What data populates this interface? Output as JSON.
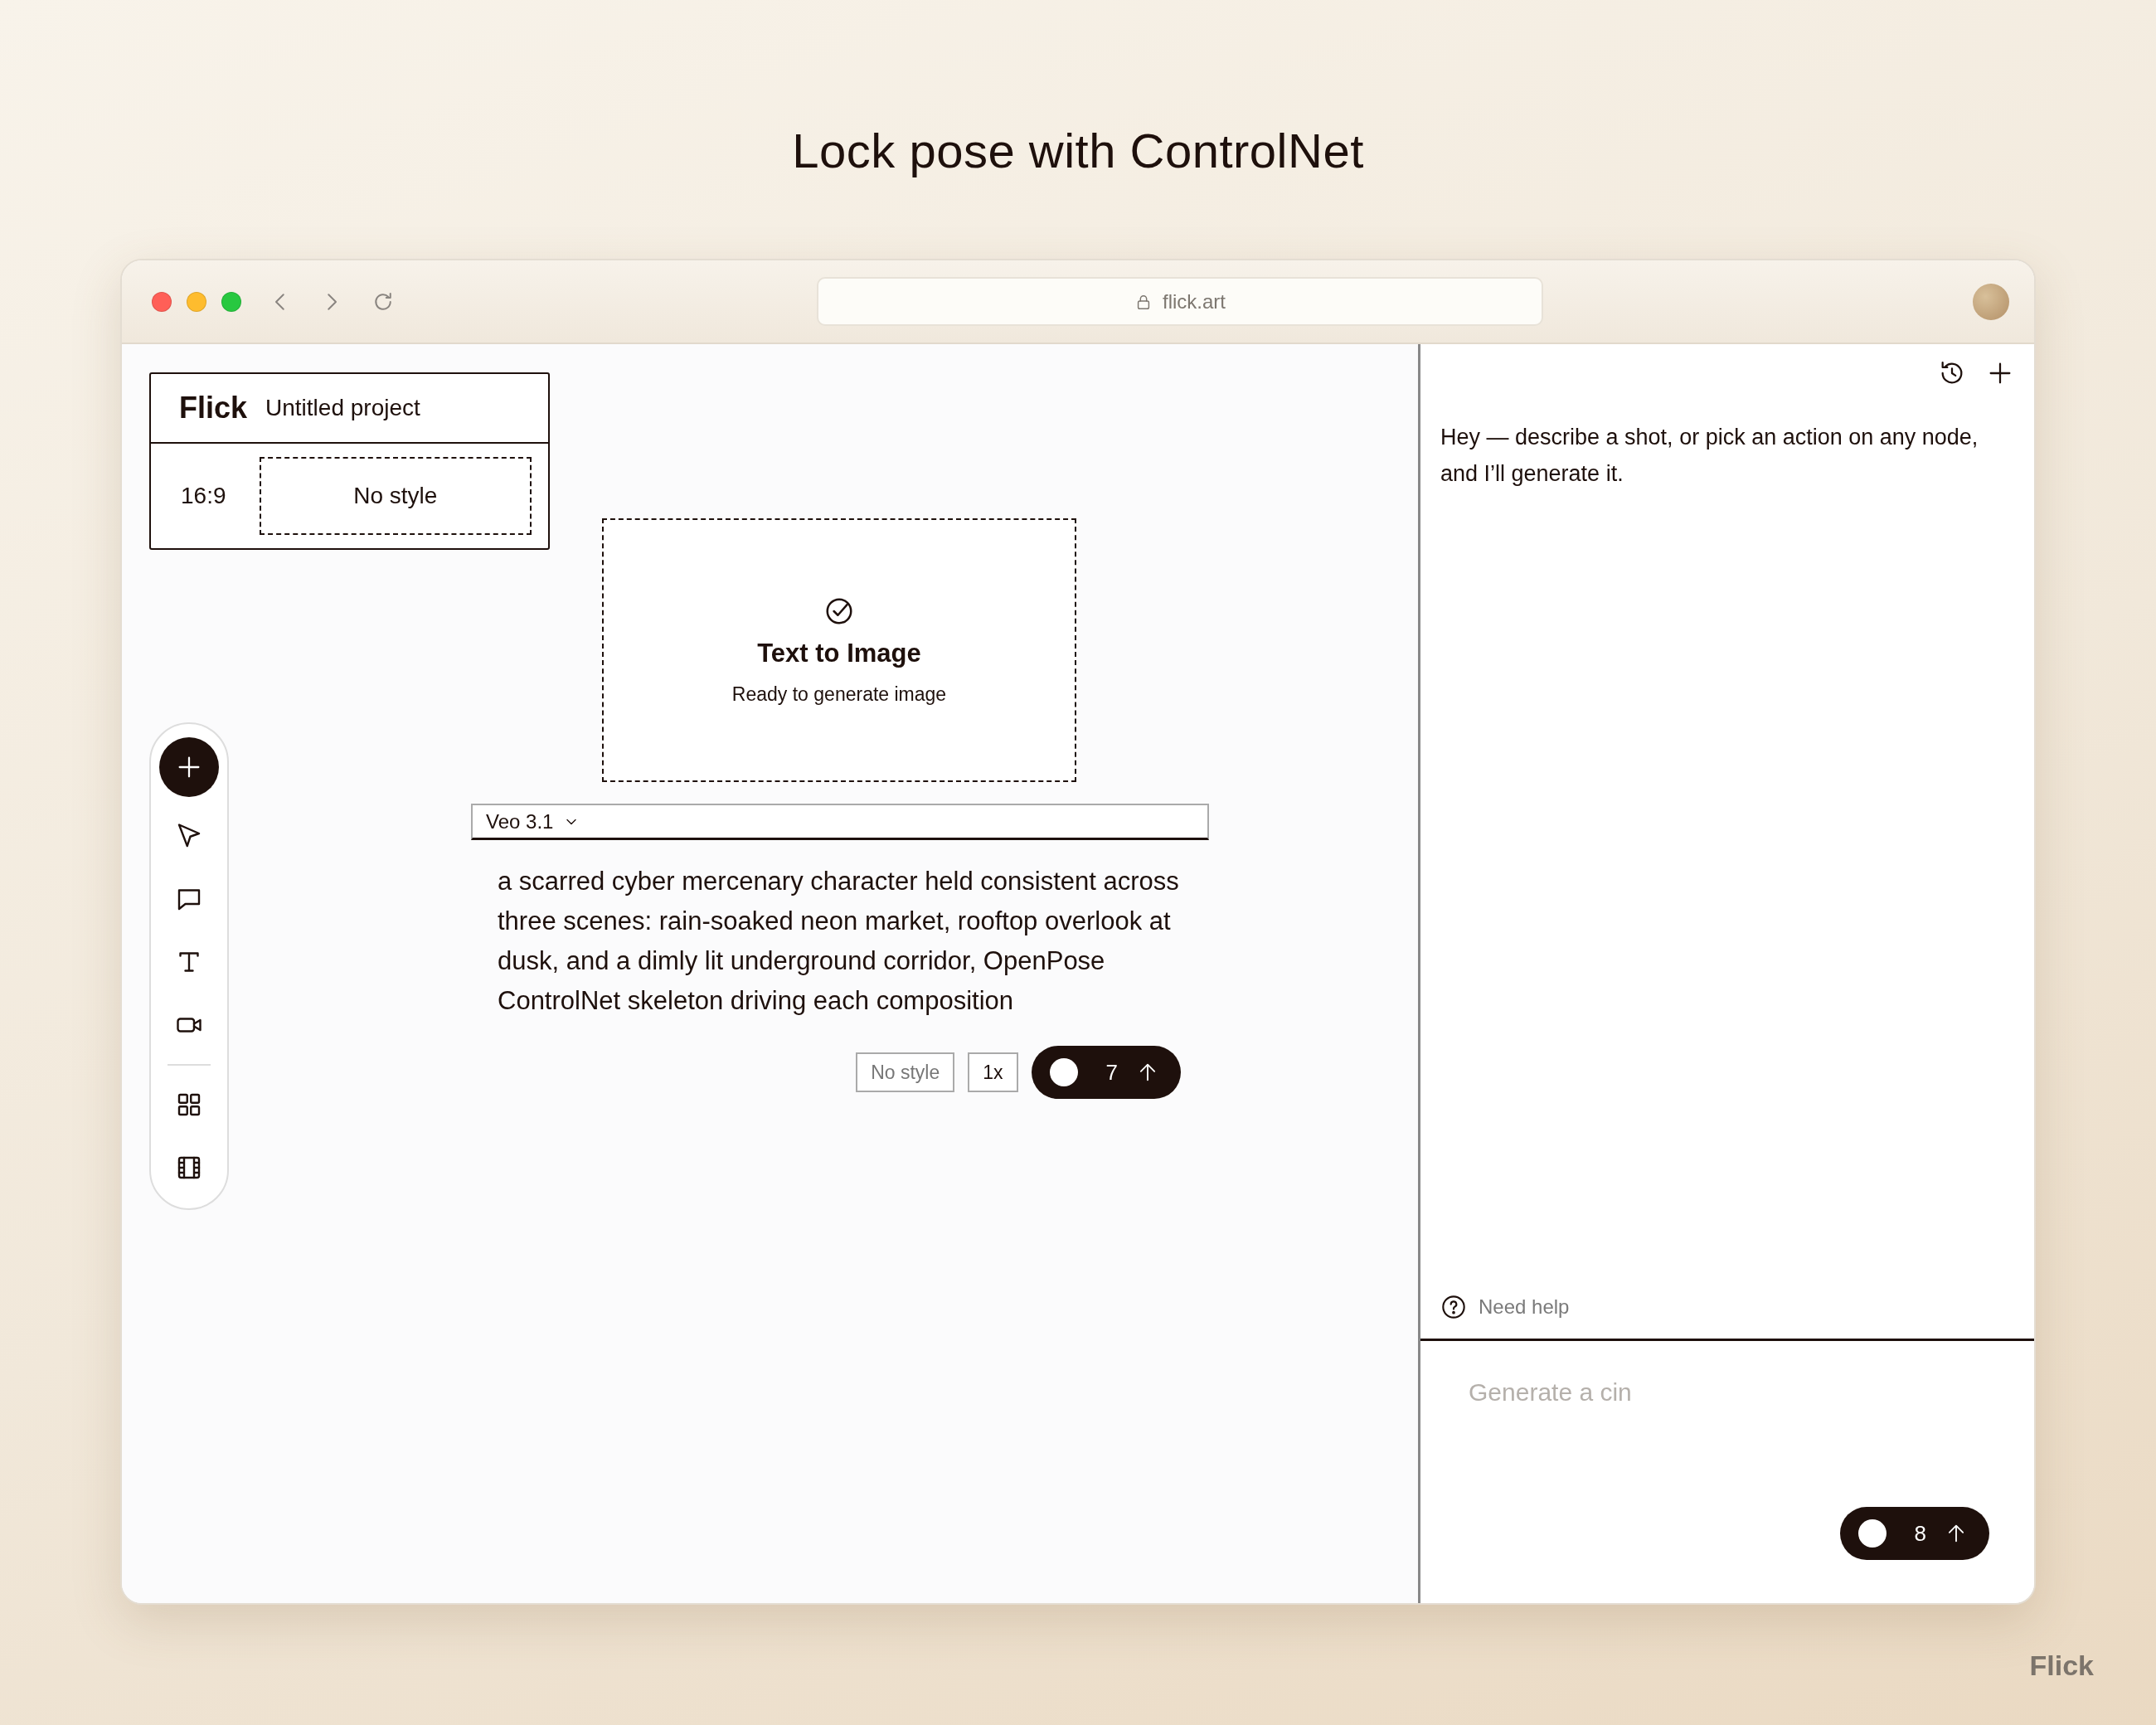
{
  "headline": "Lock pose with ControlNet",
  "browser": {
    "url": "flick.art"
  },
  "project": {
    "brand": "Flick",
    "name": "Untitled project",
    "aspect": "16:9",
    "style": "No style"
  },
  "node": {
    "title": "Text to Image",
    "status": "Ready to generate image"
  },
  "prompt": {
    "model": "Veo 3.1",
    "text": "a scarred cyber mercenary character held consistent across three scenes: rain-soaked neon market, rooftop overlook at dusk, and a dimly lit underground corridor, OpenPose ControlNet skeleton driving each composition",
    "style": "No style",
    "multiplier": "1x",
    "credits": "7"
  },
  "chat": {
    "message": "Hey — describe a shot, or pick an action on any node, and I’ll generate it.",
    "help": "Need help",
    "input": {
      "placeholder": "Generate a cin"
    },
    "credits": "8"
  },
  "brand_mark": "Flick"
}
